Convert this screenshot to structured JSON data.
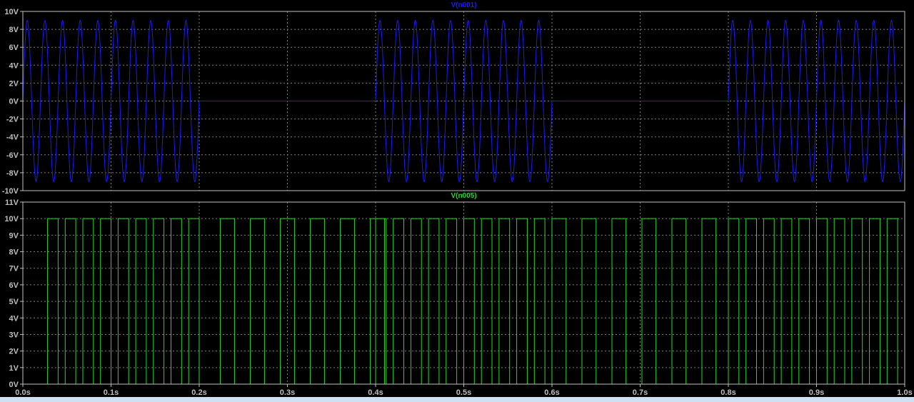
{
  "chart_data": [
    {
      "type": "line",
      "title": "V(n001)",
      "color": "#1a1aff",
      "xlim": [
        0,
        1.0
      ],
      "ylim": [
        -10,
        10
      ],
      "yticks": [
        10,
        8,
        6,
        4,
        2,
        0,
        -2,
        -4,
        -6,
        -8,
        -10
      ],
      "ytick_labels": [
        "10V",
        "8V",
        "6V",
        "4V",
        "2V",
        "0V",
        "-2V",
        "-4V",
        "-6V",
        "-8V",
        "-10V"
      ],
      "grid": true,
      "signal": {
        "shape": "sine",
        "amplitude": 9,
        "frequency_hz": 50,
        "bursts": [
          [
            0.0,
            0.2
          ],
          [
            0.4,
            0.6
          ],
          [
            0.8,
            1.0
          ]
        ]
      }
    },
    {
      "type": "line",
      "title": "V(n005)",
      "color": "#22dd22",
      "xlim": [
        0,
        1.0
      ],
      "ylim": [
        0,
        11
      ],
      "yticks": [
        11,
        10,
        9,
        8,
        7,
        6,
        5,
        4,
        3,
        2,
        1,
        0
      ],
      "ytick_labels": [
        "11V",
        "10V",
        "9V",
        "8V",
        "7V",
        "6V",
        "5V",
        "4V",
        "3V",
        "2V",
        "1V",
        "0V"
      ],
      "grid": true,
      "signal": {
        "shape": "pulse",
        "high": 10,
        "low": 0,
        "segments": [
          {
            "from": 0.028,
            "to": 0.2,
            "period": 0.02,
            "width": 0.012
          },
          {
            "from": 0.224,
            "to": 0.4,
            "period": 0.034,
            "width": 0.016
          },
          {
            "from": 0.4,
            "to": 0.6,
            "period": 0.02,
            "width": 0.012
          },
          {
            "from": 0.6,
            "to": 0.8,
            "period": 0.034,
            "width": 0.016
          },
          {
            "from": 0.8,
            "to": 1.0,
            "period": 0.02,
            "width": 0.012
          }
        ]
      }
    }
  ],
  "xaxis": {
    "ticks": [
      0,
      0.1,
      0.2,
      0.3,
      0.4,
      0.5,
      0.6,
      0.7,
      0.8,
      0.9,
      1.0
    ],
    "tick_labels": [
      "0.0s",
      "0.1s",
      "0.2s",
      "0.3s",
      "0.4s",
      "0.5s",
      "0.6s",
      "0.7s",
      "0.8s",
      "0.9s",
      "1.0s"
    ]
  }
}
